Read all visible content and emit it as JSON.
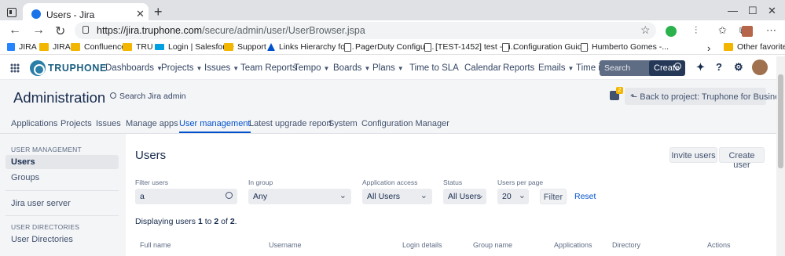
{
  "browser": {
    "tab_title": "Users - Jira",
    "tab_close": "✕",
    "new_tab": "+",
    "url_host": "https://jira.truphone.com",
    "url_path": "/secure/admin/user/UserBrowser.jspa",
    "bookmarks": [
      "JIRA",
      "JIRA",
      "Confluence",
      "TRU",
      "Login | Salesforce",
      "Support",
      "Links Hierarchy for...",
      "PagerDuty Configur...",
      "[TEST-1452] test - Ji...",
      "Configuration Guid...",
      "Humberto Gomes -...",
      "Other favorites"
    ],
    "bookmark_more": "›"
  },
  "jira_nav": {
    "logo": "TRUPHONE",
    "items": [
      "Dashboards",
      "Projects",
      "Issues",
      "Team Reports",
      "Tempo",
      "Boards",
      "Plans",
      "Time to SLA",
      "Calendar",
      "Reports",
      "Emails",
      "Time in Status"
    ],
    "search_placeholder": "Search",
    "create_label": "Create"
  },
  "admin": {
    "title": "Administration",
    "search_label": "Search Jira admin",
    "feedback_count": "2",
    "back_label": "Back to project: Truphone for Business",
    "tabs": [
      "Applications",
      "Projects",
      "Issues",
      "Manage apps",
      "User management",
      "Latest upgrade report",
      "System",
      "Configuration Manager"
    ]
  },
  "sidebar": {
    "heading_user_mgmt": "USER MANAGEMENT",
    "users": "Users",
    "groups": "Groups",
    "jira_user_server": "Jira user server",
    "heading_dirs": "USER DIRECTORIES",
    "user_directories": "User Directories"
  },
  "main": {
    "title": "Users",
    "invite_button": "Invite users",
    "create_button": "Create user",
    "filter_users_label": "Filter users",
    "filter_users_value": "a",
    "in_group_label": "In group",
    "in_group_value": "Any",
    "app_access_label": "Application access",
    "app_access_value": "All Users",
    "status_label": "Status",
    "status_value": "All Users",
    "per_page_label": "Users per page",
    "per_page_value": "20",
    "filter_button": "Filter",
    "reset_link": "Reset",
    "summary_prefix": "Displaying users ",
    "summary_from": "1",
    "summary_mid": " to ",
    "summary_to": "2",
    "summary_of": " of ",
    "summary_total": "2",
    "summary_end": ".",
    "columns": [
      "Full name",
      "Username",
      "Login details",
      "Group name",
      "Applications",
      "Directory",
      "Actions"
    ]
  },
  "colors": {
    "accent": "#0052cc",
    "nav_dark": "#253858",
    "brand": "#1a5d80"
  }
}
